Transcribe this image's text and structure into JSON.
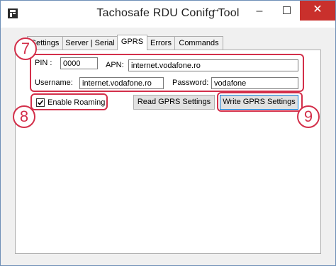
{
  "window": {
    "title": "Tachosafe  RDU Conifg Tool",
    "cursor_glyph": "↔"
  },
  "tabs": [
    {
      "label": "Settings",
      "active": false
    },
    {
      "label": "Server | Serial",
      "active": false
    },
    {
      "label": "GPRS",
      "active": true
    },
    {
      "label": "Errors",
      "active": false
    },
    {
      "label": "Commands",
      "active": false
    }
  ],
  "gprs": {
    "pin_label": "PIN :",
    "pin_value": "0000",
    "apn_label": "APN:",
    "apn_value": "internet.vodafone.ro",
    "username_label": "Username:",
    "username_value": "internet.vodafone.ro",
    "password_label": "Password:",
    "password_value": "vodafone",
    "roaming_label": "Enable Roaming",
    "roaming_checked": true,
    "read_button": "Read GPRS Settings",
    "write_button": "Write GPRS Settings"
  },
  "annotations": {
    "a7": "7",
    "a8": "8",
    "a9": "9",
    "color": "#d32f4a"
  },
  "icons": [
    "app-icon",
    "minimize-icon",
    "maximize-icon",
    "close-icon",
    "check-icon",
    "resize-cursor-icon"
  ]
}
